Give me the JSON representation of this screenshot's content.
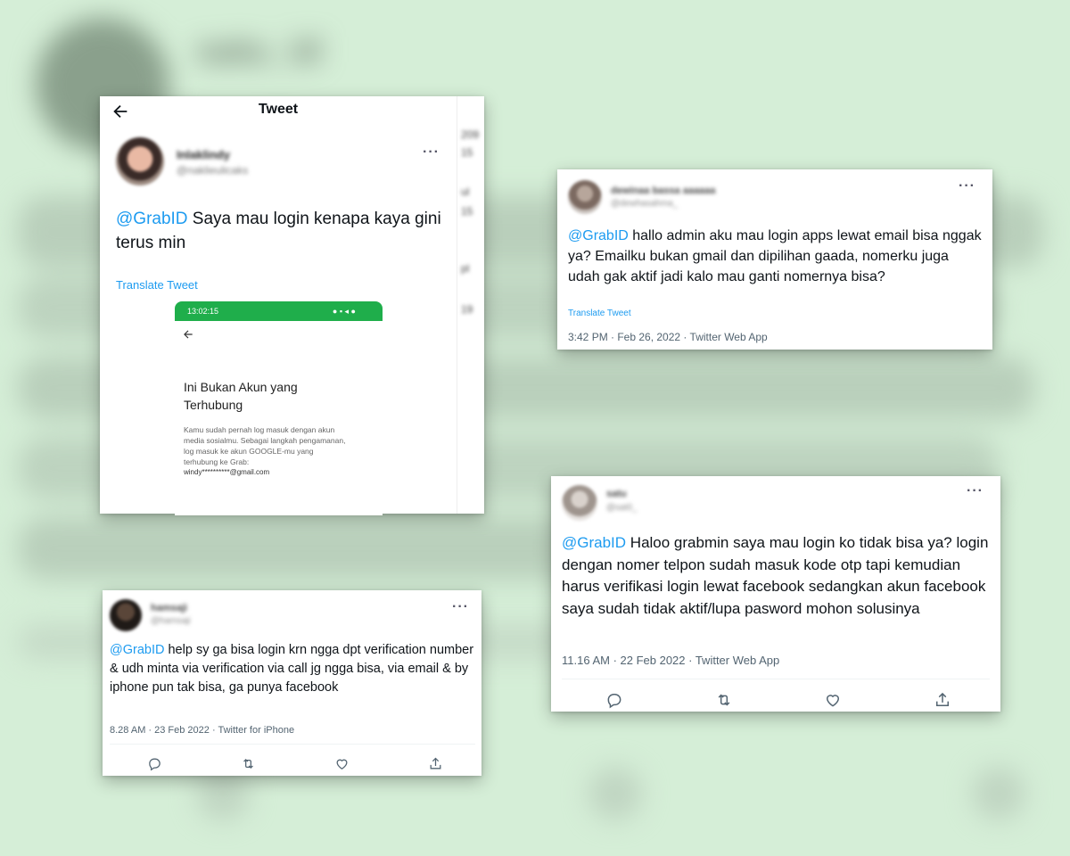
{
  "background": {
    "color": "#d5eed7",
    "header_text": "satu_id"
  },
  "card1": {
    "header_title": "Tweet",
    "user_name": "Inlaklindy",
    "user_handle": "@naklieulicaks",
    "tweet_mention": "@GrabID",
    "tweet_text": " Saya mau login kenapa kaya gini terus min",
    "translate_label": "Translate Tweet",
    "side_text": [
      "209",
      "15",
      "ul",
      "15",
      "pl",
      "19"
    ],
    "screenshot": {
      "status_time": "13:02:15",
      "title": "Ini Bukan Akun yang Terhubung",
      "body": "Kamu sudah pernah log masuk dengan akun media sosialmu. Sebagai langkah pengamanan, log masuk ke akun GOOGLE-mu yang terhubung ke Grab:",
      "email": "windy**********@gmail.com",
      "status_color": "#1fae4b"
    }
  },
  "card2": {
    "user_name": "dewinaa bassa aaaaaa",
    "user_handle": "@dewhasahma_",
    "tweet_mention": "@GrabID",
    "tweet_text": " hallo admin aku mau login apps lewat email bisa nggak ya? Emailku bukan gmail dan dipilihan gaada, nomerku juga udah gak aktif jadi kalo mau ganti nomernya bisa?",
    "translate_label": "Translate Tweet",
    "meta": "3:42 PM · Feb 26, 2022 · Twitter Web App"
  },
  "card3": {
    "user_name": "satu",
    "user_handle": "@sat0_",
    "tweet_mention": "@GrabID",
    "tweet_text": " Haloo grabmin saya mau login ko tidak bisa ya? login dengan nomer telpon sudah masuk kode otp tapi kemudian harus verifikasi login lewat facebook sedangkan akun facebook saya sudah tidak aktif/lupa pasword mohon solusinya",
    "meta": "11.16 AM · 22 Feb 2022 · Twitter Web App"
  },
  "card4": {
    "user_name": "hamsaji",
    "user_handle": "@hamsaji",
    "tweet_mention": "@GrabID",
    "tweet_text": " help sy ga bisa login krn ngga dpt verification number & udh minta via verification via call jg ngga bisa, via email & by iphone pun tak bisa, ga punya facebook",
    "meta": "8.28 AM · 23 Feb 2022 · Twitter for iPhone"
  },
  "icons": [
    "back-arrow-icon",
    "more-icon",
    "reply-icon",
    "retweet-icon",
    "like-icon",
    "share-icon"
  ],
  "colors": {
    "link": "#1d9bf0",
    "meta": "#536471",
    "text": "#0f1419"
  }
}
